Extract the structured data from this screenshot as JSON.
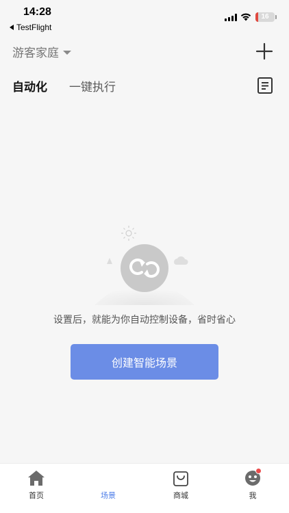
{
  "status_bar": {
    "time": "14:28",
    "back_app": "TestFlight",
    "battery_level": "16",
    "battery_percent": 16
  },
  "header": {
    "home_name": "游客家庭"
  },
  "tabs": [
    {
      "label": "自动化",
      "active": true
    },
    {
      "label": "一键执行",
      "active": false
    }
  ],
  "empty_state": {
    "message": "设置后，就能为你自动控制设备，省时省心",
    "button_label": "创建智能场景"
  },
  "tabbar": [
    {
      "label": "首页",
      "icon": "home-icon",
      "active": false
    },
    {
      "label": "场景",
      "icon": "scene-icon",
      "active": true
    },
    {
      "label": "商城",
      "icon": "shopping-bag-icon",
      "active": false
    },
    {
      "label": "我",
      "icon": "profile-face-icon",
      "active": false,
      "badge": true
    }
  ],
  "colors": {
    "accent": "#6b8de6",
    "active_tab": "#4e7ee8",
    "badge": "#ea4c4c",
    "battery_low": "#e0493f",
    "background": "#f6f6f6"
  }
}
